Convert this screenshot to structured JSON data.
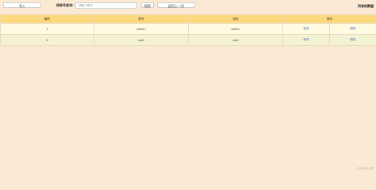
{
  "toolbar": {
    "import_label": "导入",
    "search_label": "按账号查询:",
    "search_placeholder": "请输入账号",
    "query_label": "搜索",
    "back_label": "返回上一页",
    "all_users_label": "所有的数据"
  },
  "table": {
    "headers": [
      "编号",
      "账号",
      "密码",
      "操作"
    ],
    "rows": [
      {
        "id": "1",
        "account": "admin",
        "password": "admin",
        "action_modify": "修改",
        "action_delete": "删除"
      },
      {
        "id": "2",
        "account": "user",
        "password": "user",
        "action_modify": "修改",
        "action_delete": "删除"
      }
    ]
  },
  "watermark": "CSDN @小杰"
}
